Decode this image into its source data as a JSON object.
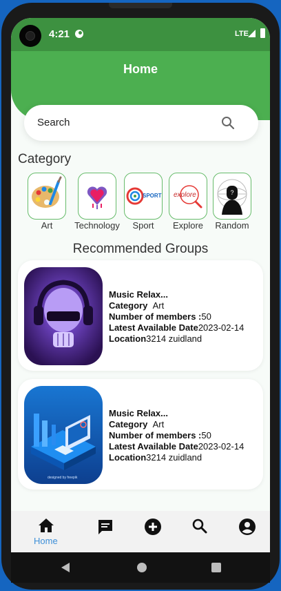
{
  "status_bar": {
    "time": "4:21",
    "network": "LTE"
  },
  "header": {
    "title": "Home"
  },
  "search": {
    "label": "Search"
  },
  "categories": {
    "title": "Category",
    "items": [
      {
        "label": "Art"
      },
      {
        "label": "Technology"
      },
      {
        "label": "Sport",
        "logo_text": "SPORT"
      },
      {
        "label": "Explore",
        "logo_text": "explore"
      },
      {
        "label": "Random"
      }
    ]
  },
  "recommended": {
    "title": "Recommended Groups",
    "groups": [
      {
        "name": "Music Relax...",
        "category_label": "Category",
        "category": "Art",
        "members_label": "Number of members :",
        "members": "50",
        "date_label": "Latest Available Date",
        "date": "2023-02-14",
        "location_label": "Location",
        "location": "3214 zuidland"
      },
      {
        "name": "Music Relax...",
        "category_label": "Category",
        "category": "Art",
        "members_label": "Number of members :",
        "members": "50",
        "date_label": "Latest Available Date",
        "date": "2023-02-14",
        "location_label": "Location",
        "location": "3214 zuidland",
        "image_caption": "designed by freepik"
      }
    ]
  },
  "bottom_nav": {
    "items": [
      {
        "label": "Home",
        "icon": "home-icon",
        "active": true
      },
      {
        "label": "",
        "icon": "chat-icon"
      },
      {
        "label": "",
        "icon": "add-circle-icon"
      },
      {
        "label": "",
        "icon": "search-icon"
      },
      {
        "label": "",
        "icon": "account-icon"
      }
    ]
  },
  "colors": {
    "primary": "#4caf50",
    "status_bar": "#3d9140",
    "active_nav": "#3d8fd8"
  }
}
